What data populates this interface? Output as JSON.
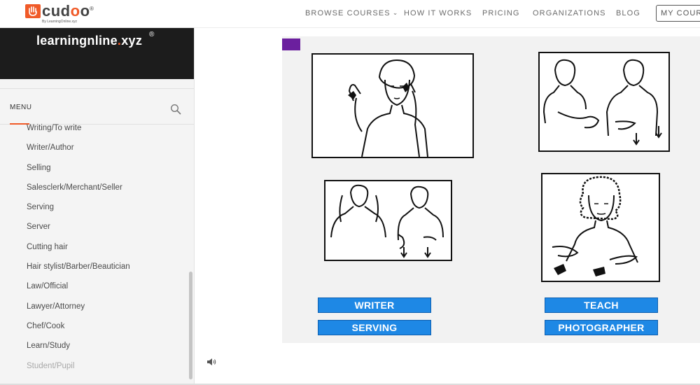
{
  "logo": {
    "word_main": "cud",
    "word_o1": "o",
    "word_o2": "o",
    "reg": "®",
    "tagline": "By LearningOnline.xyz"
  },
  "nav": {
    "browse_courses": "BROWSE COURSES",
    "how_it_works": "HOW IT WORKS",
    "pricing": "PRICING",
    "organizations": "ORGANIZATIONS",
    "blog": "BLOG",
    "my_courses": "MY COURSES"
  },
  "sidebar": {
    "brand_prefix": "learningnline",
    "brand_dot": ".",
    "brand_suffix": "xyz",
    "brand_reg": "®",
    "menu_label": "MENU",
    "items": [
      {
        "label": "Writing/To write"
      },
      {
        "label": "Writer/Author"
      },
      {
        "label": "Selling"
      },
      {
        "label": "Salesclerk/Merchant/Seller"
      },
      {
        "label": "Serving"
      },
      {
        "label": "Server"
      },
      {
        "label": "Cutting hair"
      },
      {
        "label": "Hair stylist/Barber/Beautician"
      },
      {
        "label": "Law/Official"
      },
      {
        "label": "Lawyer/Attorney"
      },
      {
        "label": "Chef/Cook"
      },
      {
        "label": "Learn/Study"
      },
      {
        "label": "Student/Pupil"
      }
    ]
  },
  "quiz": {
    "answers": {
      "writer": "WRITER",
      "serving": "SERVING",
      "teach": "TEACH",
      "photographer": "PHOTOGRAPHER"
    }
  },
  "icons": {
    "search": "search-icon",
    "chevron": "chevron-down-icon",
    "audio": "speaker-icon"
  },
  "colors": {
    "brand_orange": "#f05a28",
    "answer_blue": "#1e88e5",
    "tab_purple": "#6b1f9e",
    "banner_dark": "#1c1c1c"
  }
}
